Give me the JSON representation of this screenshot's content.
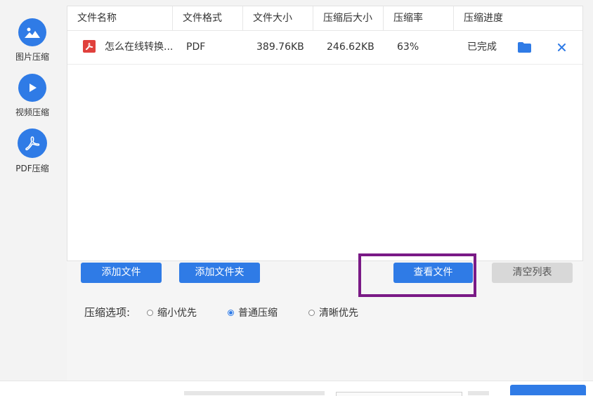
{
  "sidebar": {
    "items": [
      {
        "label": "图片压缩",
        "icon": "image-icon"
      },
      {
        "label": "视频压缩",
        "icon": "play-icon"
      },
      {
        "label": "PDF压缩",
        "icon": "pdf-icon",
        "active": true
      }
    ]
  },
  "table": {
    "headers": [
      "文件名称",
      "文件格式",
      "文件大小",
      "压缩后大小",
      "压缩率",
      "压缩进度"
    ],
    "rows": [
      {
        "name": "怎么在线转换...",
        "format": "PDF",
        "size": "389.76KB",
        "compressed_size": "246.62KB",
        "ratio": "63%",
        "progress": "已完成"
      }
    ]
  },
  "buttons": {
    "add_file": "添加文件",
    "add_folder": "添加文件夹",
    "view_files": "查看文件",
    "clear_list": "清空列表"
  },
  "options": {
    "label": "压缩选项:",
    "choices": [
      {
        "label": "缩小优先",
        "checked": false
      },
      {
        "label": "普通压缩",
        "checked": true
      },
      {
        "label": "清晰优先",
        "checked": false
      }
    ]
  },
  "colors": {
    "accent": "#2f7be6",
    "pdf_badge": "#e0403c",
    "highlight_box": "#7a1a86",
    "clear_button": "#d8d8d8"
  }
}
